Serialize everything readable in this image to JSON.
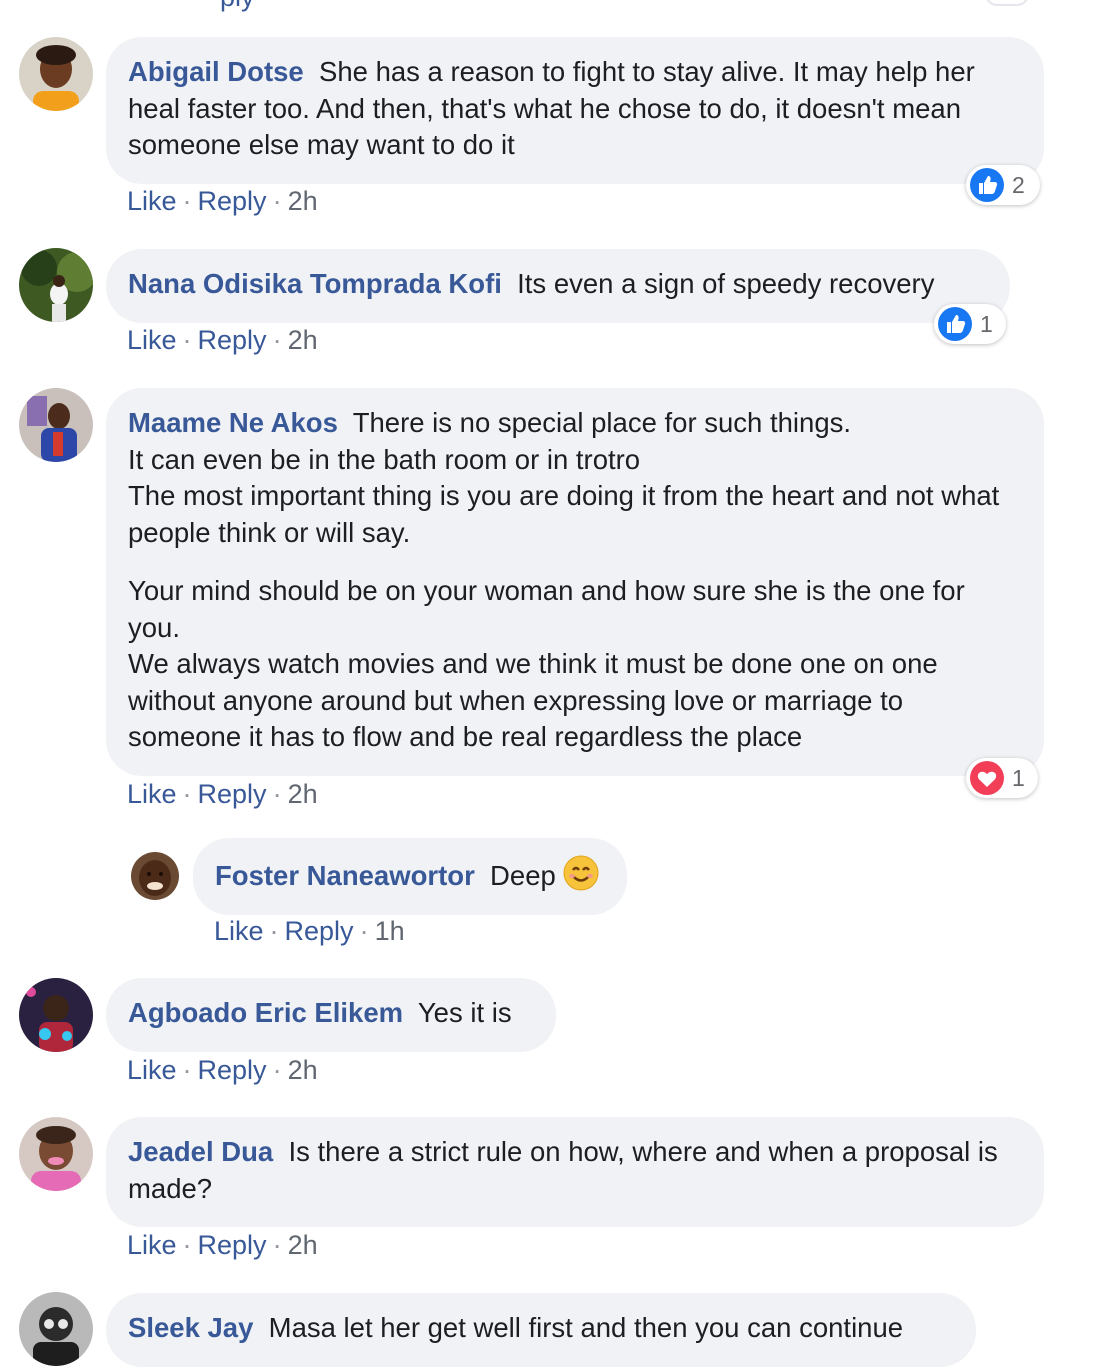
{
  "top_fragment": {
    "text": "ply"
  },
  "comments": [
    {
      "author": "Abigail Dotse",
      "text": "She has a reason to fight to stay alive. It may help her heal faster too. And then, that's what he chose to do, it doesn't mean someone else may want to do it",
      "like_label": "Like",
      "reply_label": "Reply",
      "time": "2h",
      "reaction": {
        "icon": "like-icon",
        "count": "2"
      }
    },
    {
      "author": "Nana Odisika Tomprada Kofi",
      "text": "Its even a sign of speedy recovery",
      "like_label": "Like",
      "reply_label": "Reply",
      "time": "2h",
      "reaction": {
        "icon": "like-icon",
        "count": "1"
      }
    },
    {
      "author": "Maame Ne Akos",
      "text": "There is no special place for such things.\nIt can even be in the bath room or in trotro\nThe most important thing is you are doing it from the heart and not what people think or will say.",
      "text2": "Your mind should be on your woman and how sure she is the one for you.\nWe always watch movies and we think it must be done one on one without anyone around but when expressing love or marriage to someone it has to flow and be real regardless the place",
      "like_label": "Like",
      "reply_label": "Reply",
      "time": "2h",
      "reaction": {
        "icon": "love-icon",
        "count": "1"
      }
    },
    {
      "author": "Foster Naneawortor",
      "text": "Deep",
      "emoji": "smiling-face-emoji",
      "like_label": "Like",
      "reply_label": "Reply",
      "time": "1h"
    },
    {
      "author": "Agboado Eric Elikem",
      "text": "Yes it is",
      "like_label": "Like",
      "reply_label": "Reply",
      "time": "2h"
    },
    {
      "author": "Jeadel Dua",
      "text": "Is there a strict rule on how, where and when a proposal is made?",
      "like_label": "Like",
      "reply_label": "Reply",
      "time": "2h"
    },
    {
      "author": "Sleek Jay",
      "text": "Masa let her get well first and then you can continue"
    }
  ],
  "colors": {
    "author": "#385898",
    "bubble": "#f0f2f5",
    "like_blue": "#1877f2",
    "love_red": "#f33e58"
  }
}
